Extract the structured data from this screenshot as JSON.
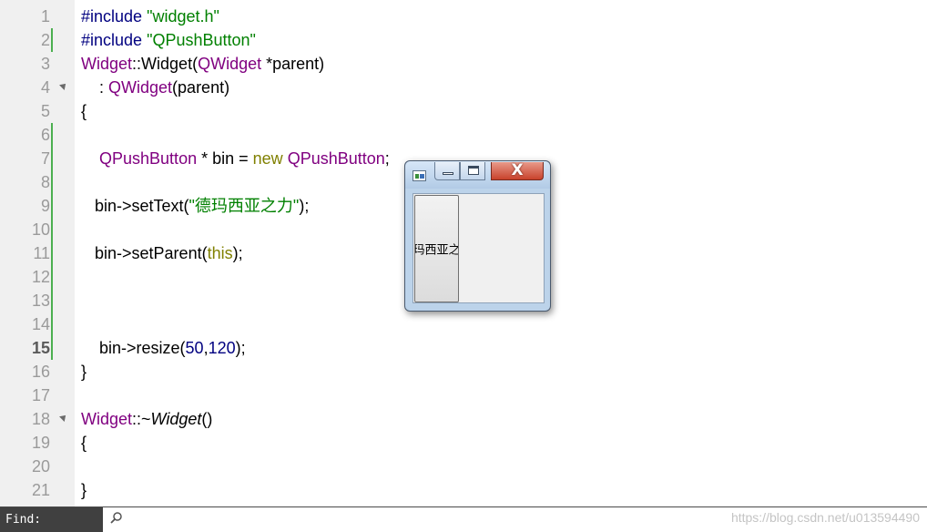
{
  "editor": {
    "lines": [
      {
        "n": "1",
        "tokens": [
          {
            "t": "#include ",
            "c": "pre"
          },
          {
            "t": "\"widget.h\"",
            "c": "str"
          }
        ]
      },
      {
        "n": "2",
        "tokens": [
          {
            "t": "#include ",
            "c": "pre"
          },
          {
            "t": "\"QPushButton\"",
            "c": "str"
          }
        ]
      },
      {
        "n": "3",
        "tokens": [
          {
            "t": "Widget",
            "c": "type"
          },
          {
            "t": "::",
            "c": ""
          },
          {
            "t": "Widget",
            "c": ""
          },
          {
            "t": "(",
            "c": ""
          },
          {
            "t": "QWidget",
            "c": "type"
          },
          {
            "t": " *parent)",
            "c": ""
          }
        ]
      },
      {
        "n": "4",
        "tokens": [
          {
            "t": "    : ",
            "c": ""
          },
          {
            "t": "QWidget",
            "c": "type"
          },
          {
            "t": "(parent)",
            "c": ""
          }
        ]
      },
      {
        "n": "5",
        "tokens": [
          {
            "t": "{",
            "c": ""
          }
        ]
      },
      {
        "n": "6",
        "tokens": []
      },
      {
        "n": "7",
        "tokens": [
          {
            "t": "    ",
            "c": ""
          },
          {
            "t": "QPushButton",
            "c": "type"
          },
          {
            "t": " * bin = ",
            "c": ""
          },
          {
            "t": "new",
            "c": "kw"
          },
          {
            "t": " ",
            "c": ""
          },
          {
            "t": "QPushButton",
            "c": "type"
          },
          {
            "t": ";",
            "c": ""
          }
        ]
      },
      {
        "n": "8",
        "tokens": []
      },
      {
        "n": "9",
        "tokens": [
          {
            "t": "   bin->setText(",
            "c": ""
          },
          {
            "t": "\"德玛西亚之力\"",
            "c": "str"
          },
          {
            "t": ");",
            "c": ""
          }
        ]
      },
      {
        "n": "10",
        "tokens": []
      },
      {
        "n": "11",
        "tokens": [
          {
            "t": "   bin->setParent(",
            "c": ""
          },
          {
            "t": "this",
            "c": "kw"
          },
          {
            "t": ");",
            "c": ""
          }
        ]
      },
      {
        "n": "12",
        "tokens": []
      },
      {
        "n": "13",
        "tokens": []
      },
      {
        "n": "14",
        "tokens": []
      },
      {
        "n": "15",
        "tokens": [
          {
            "t": "    bin->resize(",
            "c": ""
          },
          {
            "t": "50",
            "c": "num"
          },
          {
            "t": ",",
            "c": ""
          },
          {
            "t": "120",
            "c": "num"
          },
          {
            "t": ");",
            "c": ""
          }
        ]
      },
      {
        "n": "16",
        "tokens": [
          {
            "t": "}",
            "c": ""
          }
        ]
      },
      {
        "n": "17",
        "tokens": []
      },
      {
        "n": "18",
        "tokens": [
          {
            "t": "Widget",
            "c": "type"
          },
          {
            "t": "::~",
            "c": ""
          },
          {
            "t": "Widget",
            "c": "it"
          },
          {
            "t": "()",
            "c": ""
          }
        ]
      },
      {
        "n": "19",
        "tokens": [
          {
            "t": "{",
            "c": ""
          }
        ]
      },
      {
        "n": "20",
        "tokens": []
      },
      {
        "n": "21",
        "tokens": [
          {
            "t": "}",
            "c": ""
          }
        ]
      }
    ],
    "current_line": "15",
    "fold_lines": [
      "4",
      "18"
    ],
    "modified_lines": [
      "2",
      "6",
      "7",
      "8",
      "9",
      "10",
      "11",
      "12",
      "13",
      "14",
      "15"
    ],
    "colors": {
      "preprocessor": "#000080",
      "string": "#008000",
      "type": "#800080",
      "keyword": "#808000",
      "number": "#000080",
      "modified_marker": "#4caf50"
    }
  },
  "app_window": {
    "icon": "qt-app-icon",
    "minimize_icon": "minimize-icon",
    "maximize_icon": "maximize-icon",
    "close_icon": "close-icon",
    "close_glyph": "X",
    "button_label": "玛西亚之"
  },
  "find_bar": {
    "label": "Find:",
    "value": "",
    "placeholder": "",
    "search_icon": "search-icon"
  },
  "watermark": "https://blog.csdn.net/u013594490"
}
